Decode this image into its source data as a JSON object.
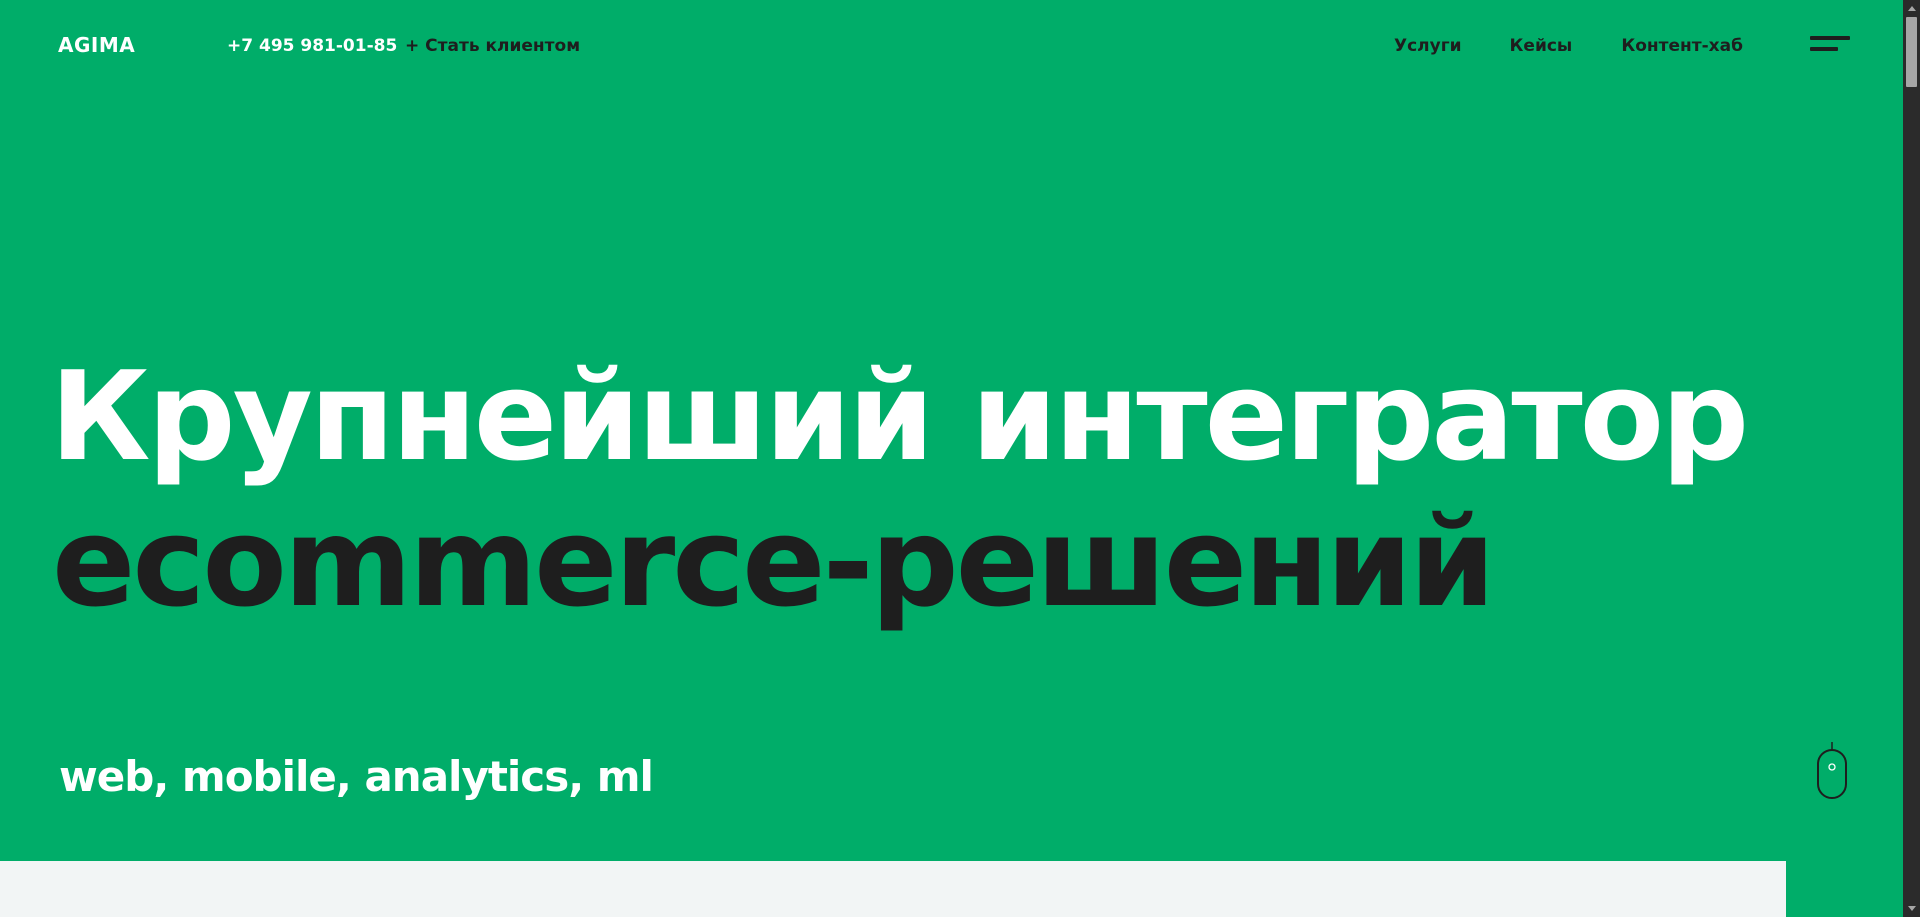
{
  "header": {
    "logo": "AGIMA",
    "phone": "+7 495 981-01-85",
    "cta_label": "+ Стать клиентом",
    "nav": [
      {
        "label": "Услуги"
      },
      {
        "label": "Кейсы"
      },
      {
        "label": "Контент-хаб"
      }
    ],
    "menu_icon": "hamburger-menu-icon"
  },
  "hero": {
    "line1": "Крупнейший интегратор",
    "line2": "ecommerce-решений",
    "subtitle": "web, mobile, analytics, ml",
    "scroll_icon": "mouse-scroll-icon"
  },
  "colors": {
    "brand_green": "#00ad69",
    "text_dark": "#1e1e1e",
    "text_light": "#ffffff",
    "panel_bg": "#f2f5f5"
  }
}
